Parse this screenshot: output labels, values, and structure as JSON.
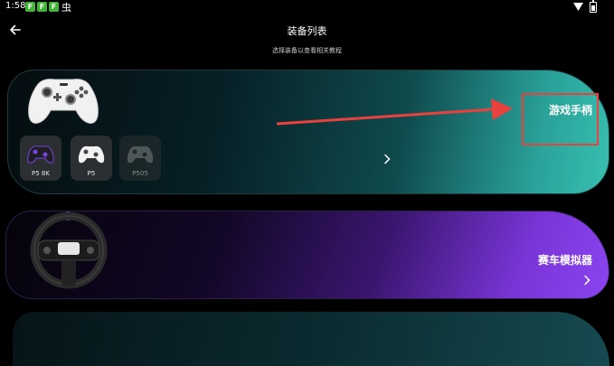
{
  "status_bar": {
    "time": "1:58",
    "app_icons": [
      "F",
      "F",
      "F"
    ],
    "bug_glyph": "虫"
  },
  "header": {
    "title": "装备列表",
    "subtitle": "选择装备以查看相关教程"
  },
  "cards": {
    "gamepad": {
      "title": "游戏手柄",
      "models": [
        "P5 8K",
        "P5",
        "P505"
      ]
    },
    "wheel": {
      "title": "赛车模拟器"
    }
  },
  "colors": {
    "gamepad_accent": "#38bfb0",
    "wheel_accent": "#8b44f0",
    "annotation": "#e8413e",
    "status_icon": "#3fb536"
  },
  "icons": [
    "back-arrow-icon",
    "wifi-icon",
    "battery-icon",
    "chevron-right-icon"
  ]
}
